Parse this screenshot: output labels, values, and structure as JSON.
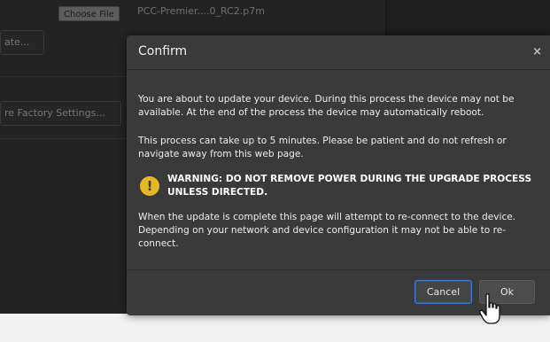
{
  "background": {
    "choose_file_label": "Choose File",
    "file_name": "PCC-Premier....0_RC2.p7m",
    "update_button_partial": "ate...",
    "factory_button_partial": "re Factory Settings..."
  },
  "modal": {
    "title": "Confirm",
    "close_glyph": "×",
    "paragraph1": "You are about to update your device. During this process the device may not be available. At the end of the process the device may automatically reboot.",
    "paragraph2": "This process can take up to 5 minutes. Please be patient and do not refresh or navigate away from this web page.",
    "warning": "WARNING: DO NOT REMOVE POWER DURING THE UPGRADE PROCESS UNLESS DIRECTED.",
    "warning_icon": "warning-icon",
    "paragraph3": "When the update is complete this page will attempt to re-connect to the device. Depending on your network and device configuration it may not be able to re-connect.",
    "cancel_label": "Cancel",
    "ok_label": "Ok"
  },
  "colors": {
    "modal_bg": "#3a3a3a",
    "warning_yellow": "#e6b820",
    "focus_blue": "#3a7bd5"
  }
}
